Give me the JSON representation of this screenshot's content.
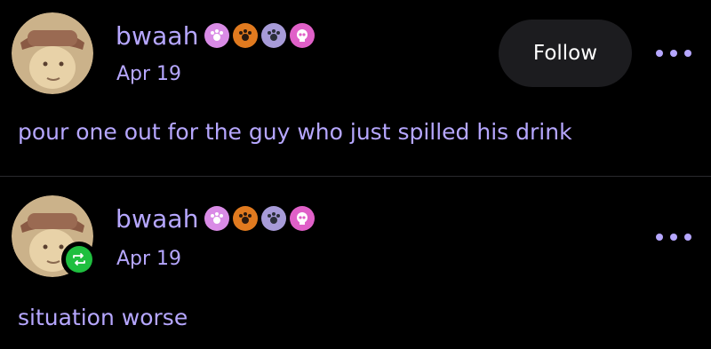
{
  "posts": [
    {
      "username": "bwaah",
      "date": "Apr 19",
      "text": "pour one out for the guy who just spilled his drink",
      "follow_label": "Follow"
    },
    {
      "username": "bwaah",
      "date": "Apr 19",
      "text": "situation worse"
    }
  ],
  "badges": [
    {
      "icon": "paw-icon",
      "color": "#d98be6"
    },
    {
      "icon": "paw-icon",
      "color": "#e07a1f"
    },
    {
      "icon": "paw-icon",
      "color": "#a79bd8"
    },
    {
      "icon": "skull-icon",
      "color": "#e060c8"
    }
  ],
  "colors": {
    "text": "#b6a7ff",
    "background": "#000000",
    "follow_bg": "#1c1c1f",
    "reblog": "#1fbf3f"
  }
}
